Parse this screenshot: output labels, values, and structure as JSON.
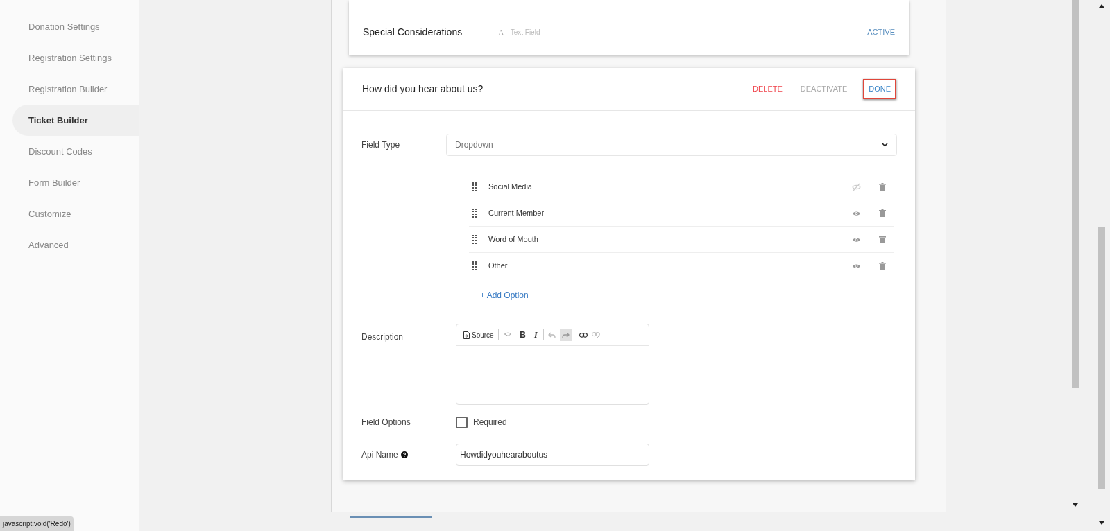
{
  "sidebar": {
    "items": [
      {
        "label": "Donation Settings",
        "selected": false
      },
      {
        "label": "Registration Settings",
        "selected": false
      },
      {
        "label": "Registration Builder",
        "selected": false
      },
      {
        "label": "Ticket Builder",
        "selected": true
      },
      {
        "label": "Discount Codes",
        "selected": false
      },
      {
        "label": "Form Builder",
        "selected": false
      },
      {
        "label": "Customize",
        "selected": false
      },
      {
        "label": "Advanced",
        "selected": false
      }
    ]
  },
  "collapsed_field": {
    "name": "Special Considerations",
    "type_icon": "A",
    "type": "Text Field",
    "status": "ACTIVE"
  },
  "editor": {
    "title": "How did you hear about us?",
    "actions": [
      {
        "label": "DELETE",
        "kind": "danger",
        "highlighted": false
      },
      {
        "label": "DEACTIVATE",
        "kind": "muted",
        "highlighted": false
      },
      {
        "label": "DONE",
        "kind": "primary",
        "highlighted": true
      }
    ],
    "field_type_label": "Field Type",
    "field_type": "Dropdown",
    "options": [
      {
        "label": "Social Media",
        "visible": false
      },
      {
        "label": "Current Member",
        "visible": true
      },
      {
        "label": "Word of Mouth",
        "visible": true
      },
      {
        "label": "Other",
        "visible": true
      }
    ],
    "add_option": "+ Add Option",
    "description_label": "Description",
    "source_button": "Source",
    "code_button": "<>",
    "bold_button": "B",
    "italic_button": "I",
    "field_options_label": "Field Options",
    "required": {
      "label": "Required",
      "checked": false
    },
    "api_name_label": "Api Name",
    "api_name": "Howdidyouhearaboutus"
  },
  "status_bar": "javascript:void('Redo')"
}
